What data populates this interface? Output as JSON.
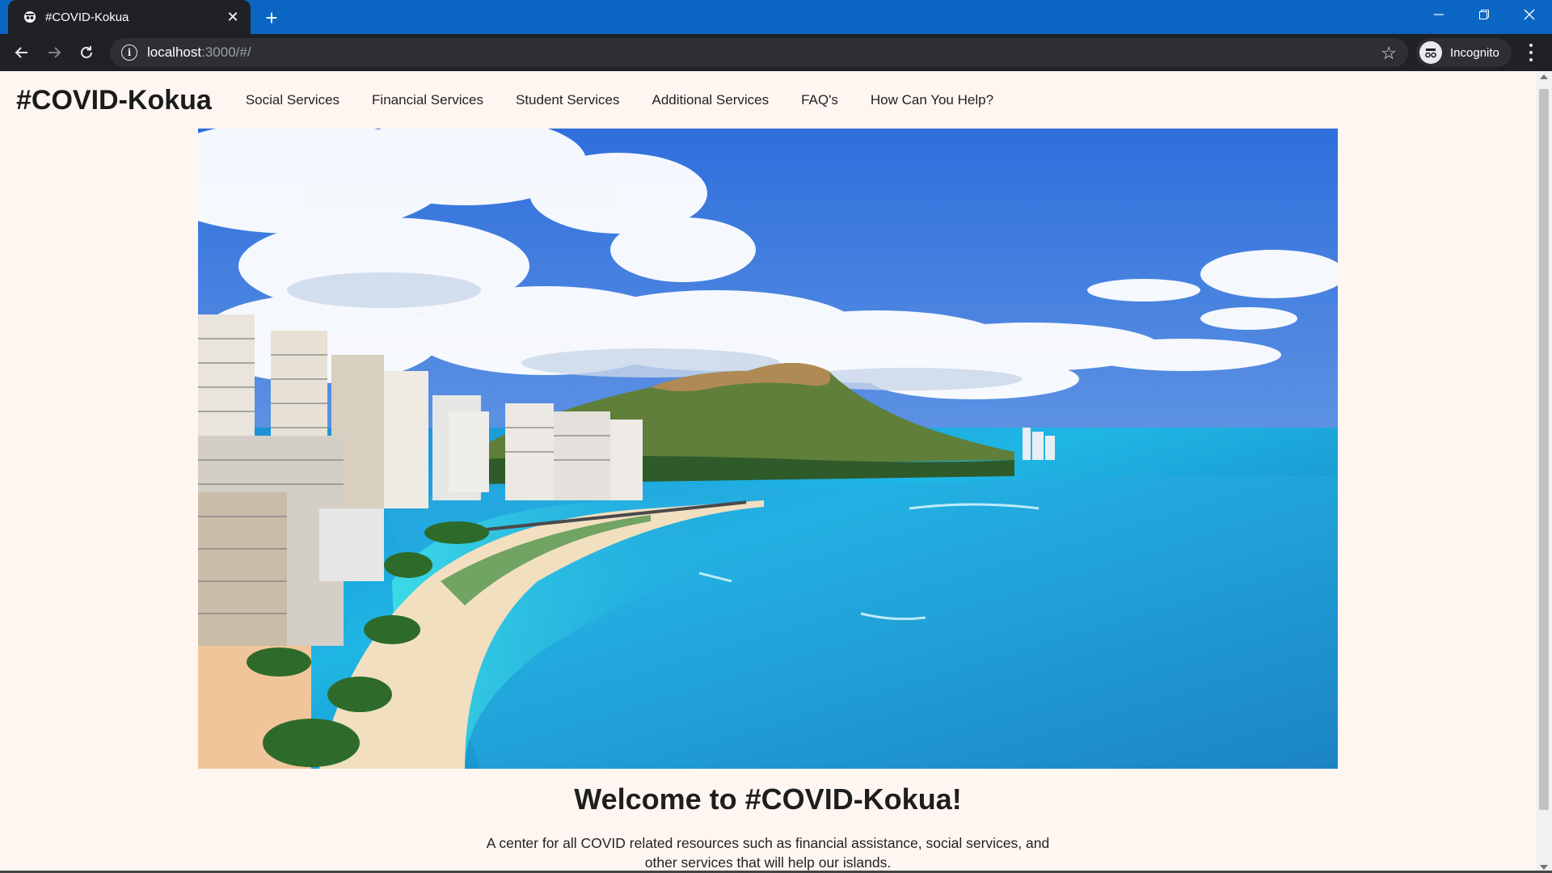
{
  "browser": {
    "tab_title": "#COVID-Kokua",
    "new_tab_symbol": "+",
    "close_tab_symbol": "✕",
    "url_host": "localhost",
    "url_rest": ":3000/#/",
    "profile_label": "Incognito",
    "icons": [
      "back-arrow-icon",
      "forward-arrow-icon",
      "reload-icon",
      "info-icon",
      "star-icon",
      "incognito-icon",
      "menu-icon",
      "minimize-icon",
      "restore-icon",
      "close-window-icon"
    ]
  },
  "site": {
    "brand": "#COVID-Kokua",
    "nav": [
      {
        "label": "Social Services"
      },
      {
        "label": "Financial Services"
      },
      {
        "label": "Student Services"
      },
      {
        "label": "Additional Services"
      },
      {
        "label": "FAQ's"
      },
      {
        "label": "How Can You Help?"
      }
    ],
    "welcome_heading": "Welcome to #COVID-Kokua!",
    "intro_text": "A center for all COVID related resources such as financial assistance, social services, and other services that will help our islands."
  },
  "colors": {
    "tab_strip": "#0b66c3",
    "toolbar": "#202124",
    "page_background": "#fff6f1"
  }
}
